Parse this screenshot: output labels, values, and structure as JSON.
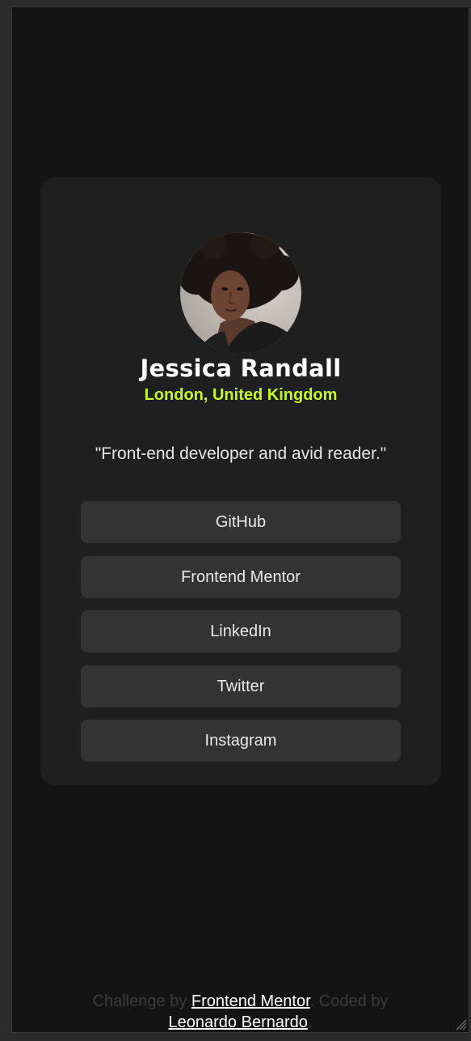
{
  "profile": {
    "name": "Jessica Randall",
    "location": "London, United Kingdom",
    "bio": "\"Front-end developer and avid reader.\""
  },
  "links": [
    {
      "label": "GitHub"
    },
    {
      "label": "Frontend Mentor"
    },
    {
      "label": "LinkedIn"
    },
    {
      "label": "Twitter"
    },
    {
      "label": "Instagram"
    }
  ],
  "footer": {
    "prefix": "Challenge by ",
    "challenge_link": "Frontend Mentor",
    "middle": ". Coded by ",
    "author_link": "Leonardo Bernardo",
    "suffix": "."
  },
  "colors": {
    "background": "#141414",
    "card": "#1f1f1f",
    "button": "#333333",
    "accent": "#c4f82a",
    "text": "#ffffff"
  }
}
